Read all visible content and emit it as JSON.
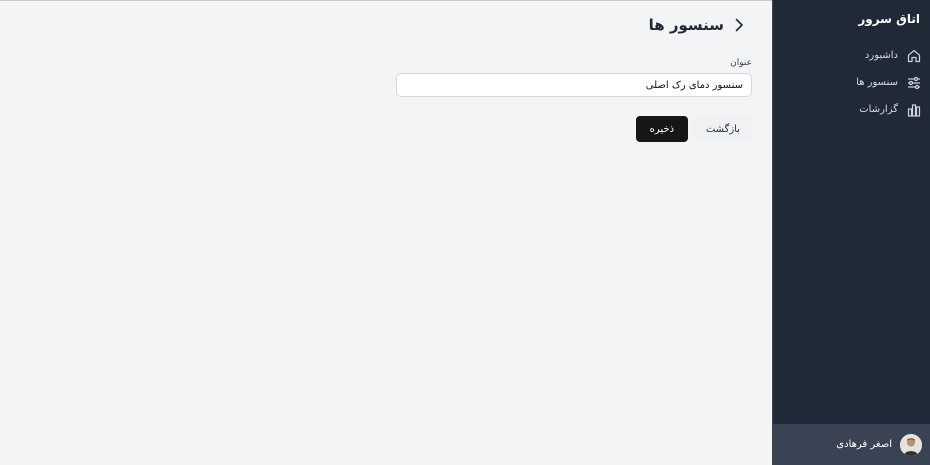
{
  "sidebar": {
    "brand": "اتاق سرور",
    "items": [
      {
        "label": "داشبورد",
        "icon": "home-icon"
      },
      {
        "label": "سنسور ها",
        "icon": "sliders-icon"
      },
      {
        "label": "گزارشات",
        "icon": "bar-chart-icon"
      }
    ],
    "user": {
      "name": "اصغر فرهادی",
      "icon": "avatar"
    }
  },
  "header": {
    "title": "سنسور ها",
    "back_icon": "chevron-right-icon"
  },
  "form": {
    "title_label": "عنوان",
    "title_value": "سنسور دمای رک اصلی"
  },
  "actions": {
    "back_label": "بازگشت",
    "save_label": "ذخیره"
  },
  "colors": {
    "sidebar_bg": "#202938",
    "user_bg": "#3a4353",
    "page_bg": "#f3f4f6",
    "primary_button": "#161616"
  }
}
